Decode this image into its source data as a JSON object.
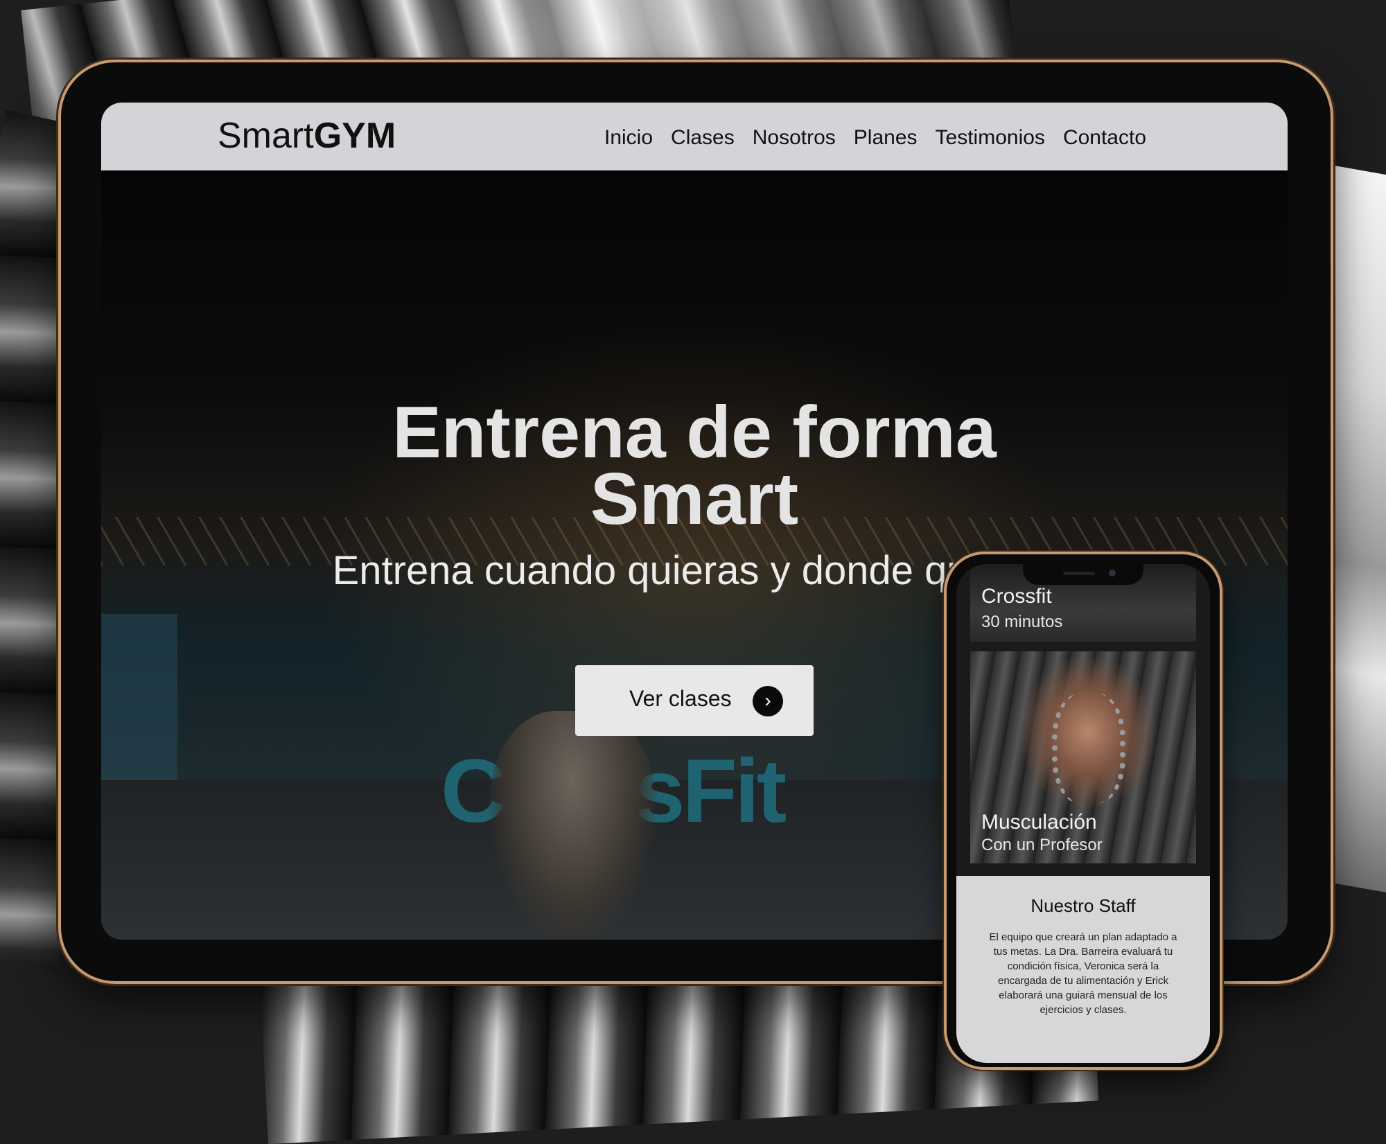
{
  "site": {
    "logo_regular": "Smart",
    "logo_bold": "GYM"
  },
  "nav": {
    "items": [
      {
        "label": "Inicio"
      },
      {
        "label": "Clases"
      },
      {
        "label": "Nosotros"
      },
      {
        "label": "Planes"
      },
      {
        "label": "Testimonios"
      },
      {
        "label": "Contacto"
      }
    ]
  },
  "hero": {
    "title_line1": "Entrena de forma",
    "title_line2": "Smart",
    "subtitle": "Entrena cuando quieras y donde quieras",
    "cta_label": "Ver clases",
    "cta_icon": "chevron-right-icon",
    "background_sign": "CrossFit"
  },
  "mobile": {
    "cards": [
      {
        "title": "Crossfit",
        "subtitle": "30 minutos"
      },
      {
        "title": "Musculación",
        "subtitle": "Con un Profesor"
      }
    ],
    "staff": {
      "title": "Nuestro Staff",
      "text": "El equipo que creará un plan adaptado a tus metas. La Dra. Barreira evaluará tu condición física, Veronica será la encargada de tu alimentación y Erick elaborará una guiará mensual de los ejercicios y clases."
    }
  },
  "colors": {
    "navbar_bg": "#d4d4d8",
    "device_frame": "#c79a6f",
    "cta_bg": "#e8e8e8"
  }
}
